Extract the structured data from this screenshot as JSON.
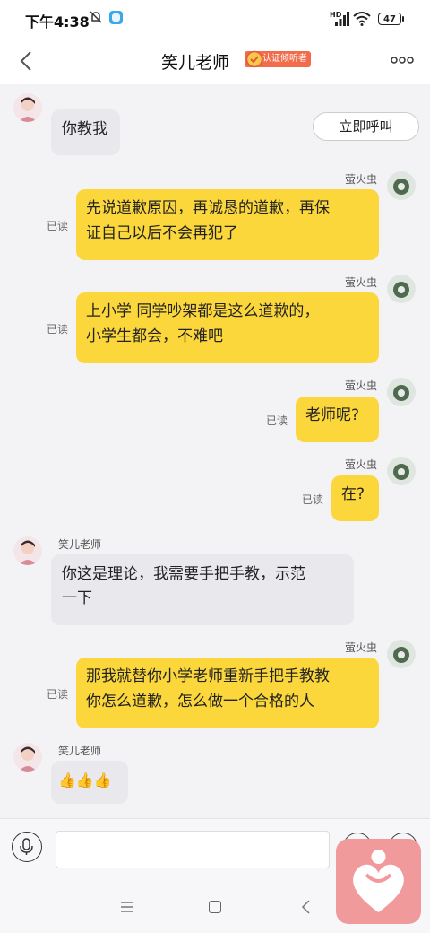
{
  "status_bar": {
    "time": "下午4:38",
    "battery": "47",
    "network": "HD"
  },
  "header": {
    "title": "笑儿老师",
    "badge": "认证倾听者"
  },
  "call_button": "立即呼叫",
  "messages": [
    {
      "sender": "笑儿老师",
      "side": "left",
      "text": "你教我"
    },
    {
      "sender": "萤火虫",
      "side": "right",
      "read": "已读",
      "lines": [
        "先说道歉原因，再诚恳的道歉，再保",
        "证自己以后不会再犯了"
      ]
    },
    {
      "sender": "萤火虫",
      "side": "right",
      "read": "已读",
      "lines": [
        "上小学 同学吵架都是这么道歉的，",
        "小学生都会，不难吧"
      ]
    },
    {
      "sender": "萤火虫",
      "side": "right",
      "read": "已读",
      "text": "老师呢?"
    },
    {
      "sender": "萤火虫",
      "side": "right",
      "read": "已读",
      "text": "在?"
    },
    {
      "sender": "笑儿老师",
      "side": "left",
      "lines": [
        "你这是理论，我需要手把手教，示范",
        "一下"
      ]
    },
    {
      "sender": "萤火虫",
      "side": "right",
      "read": "已读",
      "lines": [
        "那我就替你小学老师重新手把手教教",
        "你怎么道歉，怎么做一个合格的人"
      ]
    },
    {
      "sender": "笑儿老师",
      "side": "left",
      "text": "👍👍👍"
    }
  ],
  "input": {
    "placeholder": ""
  },
  "icons": {
    "back": "chevron-left-icon",
    "more": "more-dots-icon",
    "mic": "microphone-icon",
    "emoji": "emoji-icon",
    "plus": "plus-icon",
    "heart": "heart-person-icon",
    "verified": "verified-seal-icon"
  },
  "colors": {
    "my_bubble": "#fbd73c",
    "their_bubble": "#e9e9ed",
    "badge": "#f26b4b",
    "heart_widget": "#f09a9c"
  }
}
